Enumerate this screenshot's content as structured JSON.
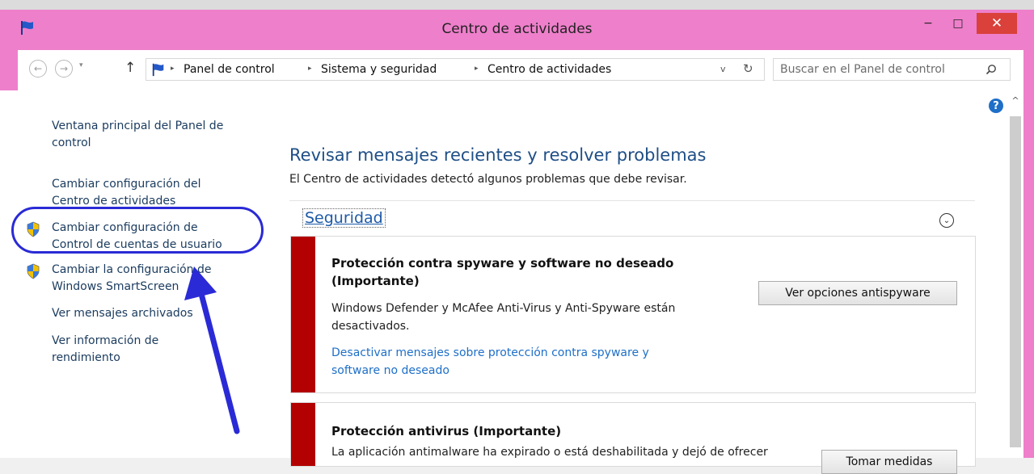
{
  "window": {
    "title": "Centro de actividades",
    "buttons": {
      "minimize": "−",
      "maximize": "□",
      "close": "✕"
    }
  },
  "nav": {
    "back_icon": "←",
    "forward_icon": "→",
    "recent_icon": "▾",
    "up_icon": "↑",
    "breadcrumb": [
      "Panel de control",
      "Sistema y seguridad",
      "Centro de actividades"
    ],
    "separator": "▸",
    "dropdown_icon": "v",
    "refresh_icon": "↻"
  },
  "search": {
    "placeholder": "Buscar en el Panel de control"
  },
  "sidebar": {
    "links": [
      {
        "label_lines": [
          "Ventana principal del Panel de",
          "control"
        ],
        "shield": false
      },
      {
        "label_lines": [
          "Cambiar configuración del",
          "Centro de actividades"
        ],
        "shield": false
      },
      {
        "label_lines": [
          "Cambiar configuración de",
          "Control de cuentas de usuario"
        ],
        "shield": true
      },
      {
        "label_lines": [
          "Cambiar la configuración de",
          "Windows SmartScreen"
        ],
        "shield": true
      },
      {
        "label_lines": [
          "Ver mensajes archivados"
        ],
        "shield": false
      },
      {
        "label_lines": [
          "Ver información de",
          "rendimiento"
        ],
        "shield": false
      }
    ]
  },
  "main": {
    "heading": "Revisar mensajes recientes y resolver problemas",
    "subtext": "El Centro de actividades detectó algunos problemas que debe revisar.",
    "section": {
      "title": "Seguridad",
      "collapse_icon": "⌄"
    },
    "cards": [
      {
        "title_lines": [
          "Protección contra spyware y software no deseado",
          "(Importante)"
        ],
        "desc_lines": [
          "Windows Defender y McAfee Anti-Virus y Anti-Spyware están",
          "desactivados."
        ],
        "link_lines": [
          "Desactivar mensajes sobre protección contra spyware y",
          "software no deseado"
        ],
        "button": "Ver opciones antispyware"
      },
      {
        "title_lines": [
          "Protección antivirus (Importante)"
        ],
        "desc_lines": [
          "La aplicación antimalware ha expirado o está deshabilitada y dejó de ofrecer"
        ],
        "button": "Tomar medidas"
      }
    ]
  },
  "help_icon": "?",
  "scrollbar": {
    "up_icon": "^"
  },
  "colors": {
    "titlebar": "#ee7fcb",
    "close_button": "#d9413a",
    "link": "#1a3b5e",
    "heading": "#1e4e86",
    "critical_stripe": "#b30000",
    "annotation": "#2a2ad6"
  }
}
